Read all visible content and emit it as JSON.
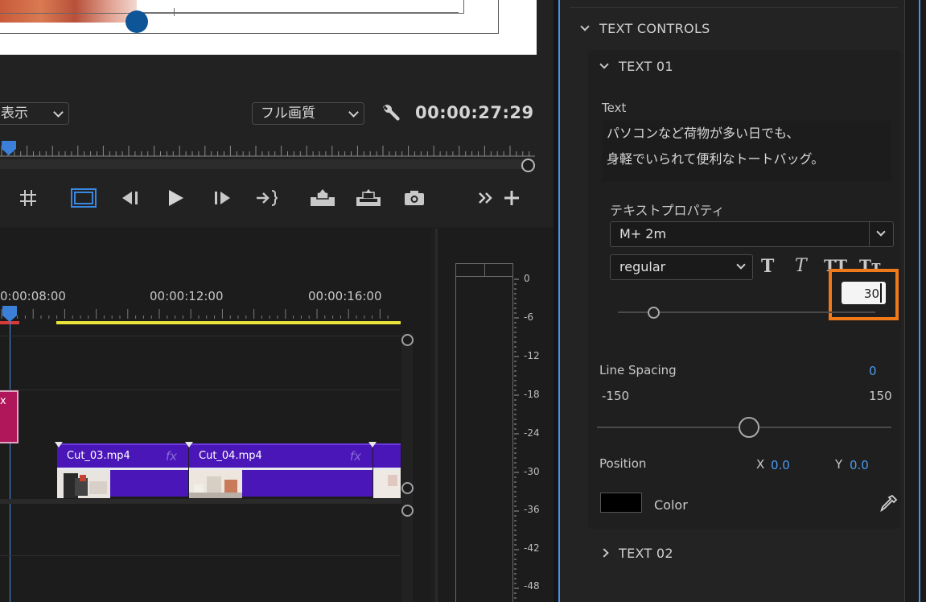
{
  "program_monitor": {
    "display_dropdown": "表示",
    "quality_dropdown": "フル画質",
    "timecode": "00:00:27:29"
  },
  "timeline": {
    "ruler_labels": [
      "0:00:08:00",
      "00:00:12:00",
      "00:00:16:00"
    ],
    "clips": [
      {
        "name": "Cut_03.mp4",
        "fx": "fx"
      },
      {
        "name": "Cut_04.mp4",
        "fx": "fx"
      }
    ],
    "pink_clip_fx": "x"
  },
  "audio_meter": {
    "scale": [
      "0",
      "-6",
      "-12",
      "-18",
      "-24",
      "-30",
      "-36",
      "-42",
      "-48"
    ]
  },
  "panel": {
    "section_title": "TEXT CONTROLS",
    "text01": {
      "title": "TEXT 01",
      "text_label": "Text",
      "text_line1": "パソコンなど荷物が多い日でも、",
      "text_line2": "身軽でいられて便利なトートバッグ。",
      "properties_label": "テキストプロパティ",
      "font": "M+ 2m",
      "font_style": "regular",
      "style_buttons": [
        "T",
        "T",
        "TT",
        "Tт"
      ],
      "font_size": "30",
      "line_spacing_label": "Line Spacing",
      "line_spacing_value": "0",
      "line_spacing_min": "-150",
      "line_spacing_max": "150",
      "position_label": "Position",
      "x_label": "X",
      "x_value": "0.0",
      "y_label": "Y",
      "y_value": "0.0",
      "color_label": "Color",
      "color_value": "#000000"
    },
    "text02": {
      "title": "TEXT 02"
    }
  },
  "colors": {
    "accent_blue": "#4a9cf0",
    "highlight_orange": "#f07a1a",
    "clip_purple": "#4a16b8",
    "clip_pink": "#b0175a",
    "work_area_yellow": "#e8e43a"
  }
}
